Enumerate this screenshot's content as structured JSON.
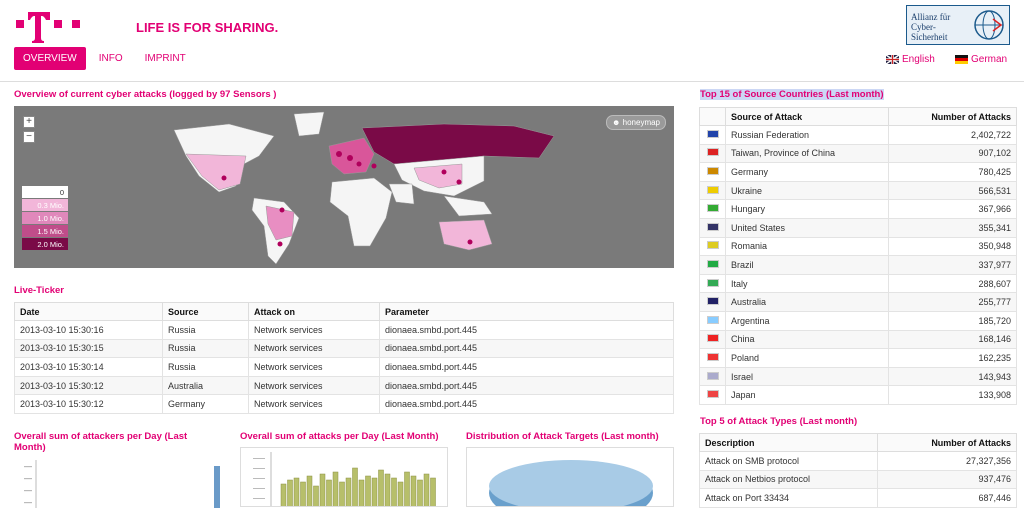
{
  "header": {
    "slogan": "LIFE IS FOR SHARING.",
    "nav": [
      "OVERVIEW",
      "INFO",
      "IMPRINT"
    ],
    "allianz_text": "Allianz für Cyber-Sicherheit",
    "lang_english": "English",
    "lang_german": "German",
    "brand_color": "#e20074"
  },
  "map": {
    "title": "Overview of current cyber attacks (logged by 97 Sensors )",
    "zoom_in": "+",
    "zoom_out": "−",
    "badge": "honeymap",
    "legend": [
      "0",
      "0.3 Mio.",
      "1.0 Mio.",
      "1.5 Mio.",
      "2.0 Mio."
    ]
  },
  "ticker": {
    "title": "Live-Ticker",
    "headers": [
      "Date",
      "Source",
      "Attack on",
      "Parameter"
    ],
    "rows": [
      [
        "2013-03-10 15:30:16",
        "Russia",
        "Network services",
        "dionaea.smbd.port.445"
      ],
      [
        "2013-03-10 15:30:15",
        "Russia",
        "Network services",
        "dionaea.smbd.port.445"
      ],
      [
        "2013-03-10 15:30:14",
        "Russia",
        "Network services",
        "dionaea.smbd.port.445"
      ],
      [
        "2013-03-10 15:30:12",
        "Australia",
        "Network services",
        "dionaea.smbd.port.445"
      ],
      [
        "2013-03-10 15:30:12",
        "Germany",
        "Network services",
        "dionaea.smbd.port.445"
      ]
    ]
  },
  "countries": {
    "title": "Top 15 of Source Countries (Last month)",
    "headers": [
      "Source of Attack",
      "Number of Attacks"
    ],
    "rows": [
      {
        "name": "Russian Federation",
        "value": "2,402,722",
        "flag": "#2244aa"
      },
      {
        "name": "Taiwan, Province of China",
        "value": "907,102",
        "flag": "#d22"
      },
      {
        "name": "Germany",
        "value": "780,425",
        "flag": "#c80"
      },
      {
        "name": "Ukraine",
        "value": "566,531",
        "flag": "#ec0"
      },
      {
        "name": "Hungary",
        "value": "367,966",
        "flag": "#3a3"
      },
      {
        "name": "United States",
        "value": "355,341",
        "flag": "#336"
      },
      {
        "name": "Romania",
        "value": "350,948",
        "flag": "#dc2"
      },
      {
        "name": "Brazil",
        "value": "337,977",
        "flag": "#2a4"
      },
      {
        "name": "Italy",
        "value": "288,607",
        "flag": "#3a5"
      },
      {
        "name": "Australia",
        "value": "255,777",
        "flag": "#226"
      },
      {
        "name": "Argentina",
        "value": "185,720",
        "flag": "#8cf"
      },
      {
        "name": "China",
        "value": "168,146",
        "flag": "#e22"
      },
      {
        "name": "Poland",
        "value": "162,235",
        "flag": "#e33"
      },
      {
        "name": "Israel",
        "value": "143,943",
        "flag": "#aac"
      },
      {
        "name": "Japan",
        "value": "133,908",
        "flag": "#e44"
      }
    ]
  },
  "attack_types": {
    "title": "Top 5 of Attack Types (Last month)",
    "headers": [
      "Description",
      "Number of Attacks"
    ],
    "rows": [
      [
        "Attack on SMB protocol",
        "27,327,356"
      ],
      [
        "Attack on Netbios protocol",
        "937,476"
      ],
      [
        "Attack on Port 33434",
        "687,446"
      ]
    ]
  },
  "charts": {
    "attackers_title": "Overall sum of attackers per Day (Last Month)",
    "attacks_title": "Overall sum of attacks per Day (Last Month)",
    "targets_title": "Distribution of Attack Targets (Last month)"
  }
}
